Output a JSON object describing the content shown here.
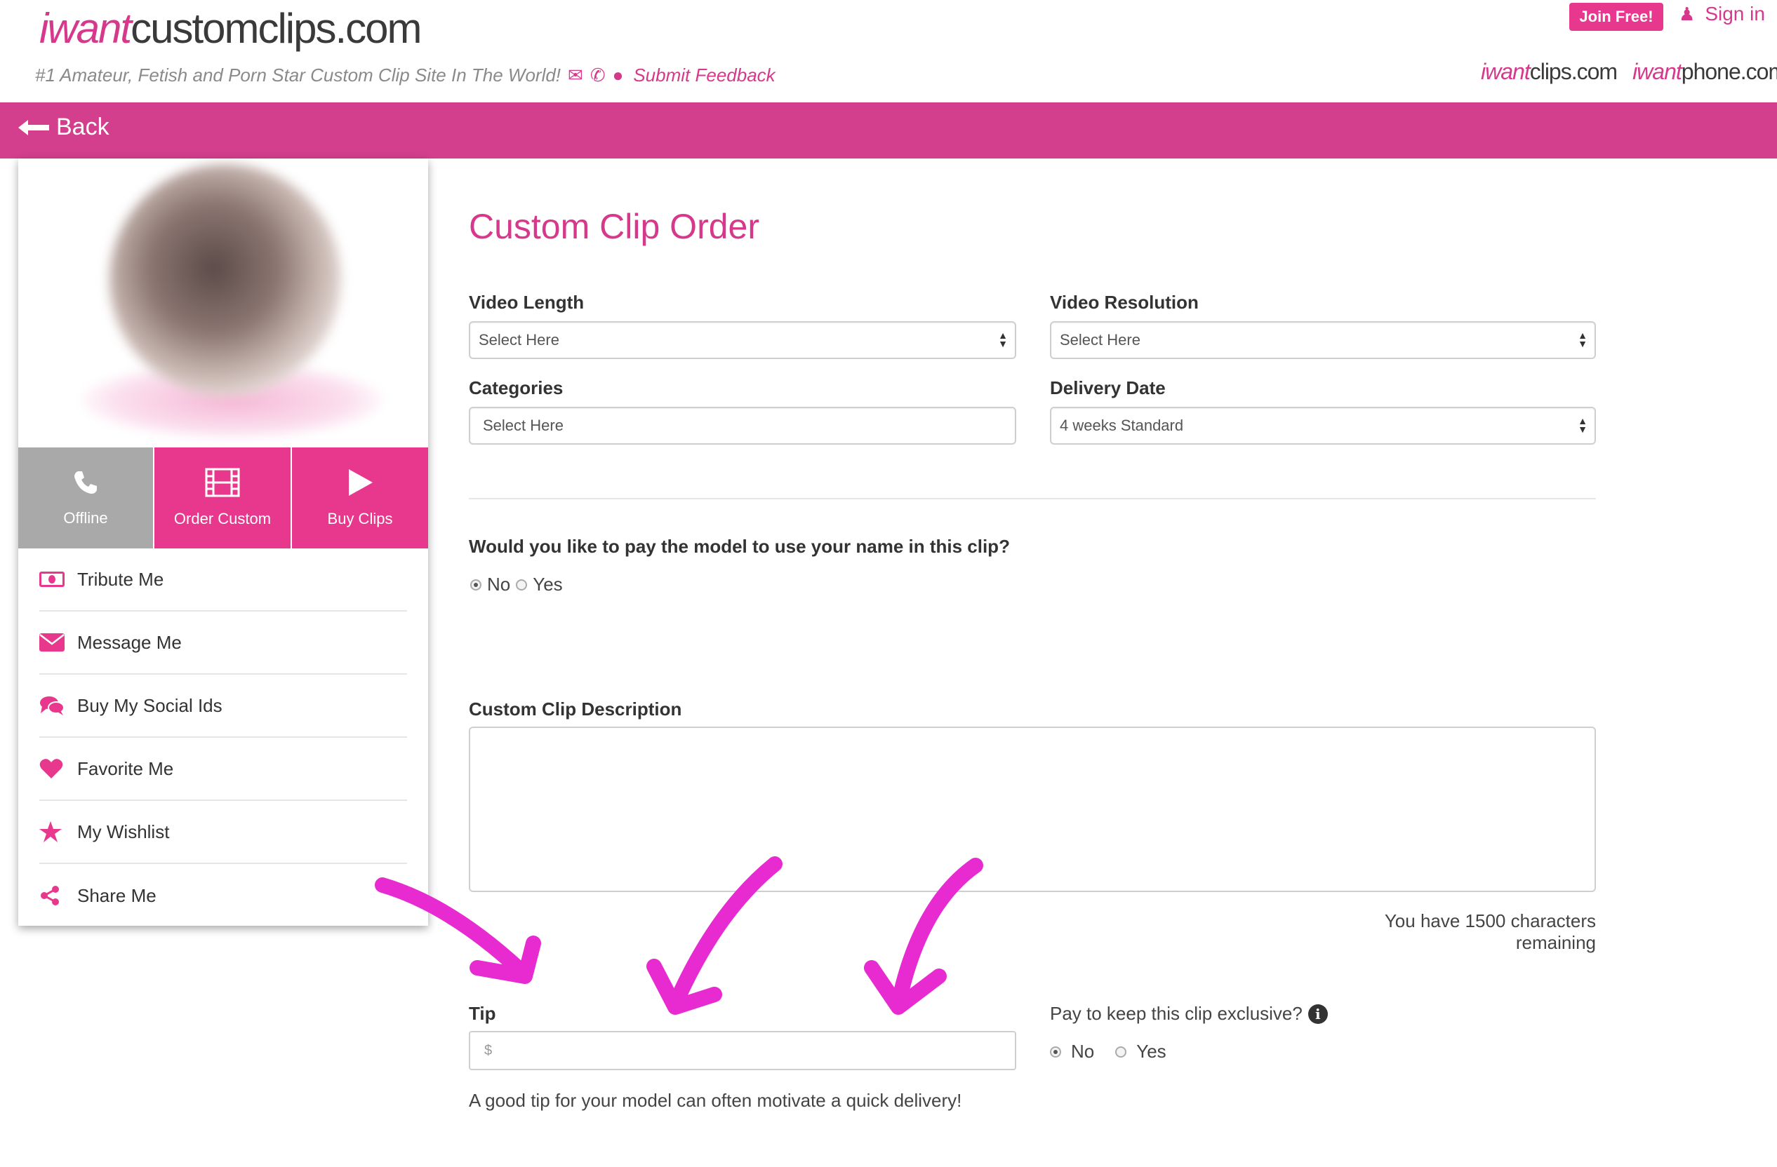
{
  "header": {
    "logo_prefix": "iwant",
    "logo_suffix": "customclips.com",
    "tagline": "#1 Amateur, Fetish and Porn Star Custom Clip Site In The World!",
    "feedback_label": "Submit Feedback",
    "join_label": "Join Free!",
    "signin_label": "Sign in",
    "sister_sites": [
      {
        "prefix": "iwant",
        "suffix": "clips.com"
      },
      {
        "prefix": "iwant",
        "suffix": "phone.com"
      }
    ],
    "icons": [
      "envelope-icon",
      "phone-icon",
      "chat-bubble-icon",
      "user-icon"
    ]
  },
  "topbar": {
    "back_label": "Back",
    "color": "#d43f8d"
  },
  "profile": {
    "actions": [
      {
        "label": "Offline",
        "icon": "phone-icon"
      },
      {
        "label": "Order Custom",
        "icon": "film-icon"
      },
      {
        "label": "Buy Clips",
        "icon": "play-icon"
      }
    ],
    "menu": [
      {
        "label": "Tribute Me",
        "icon": "money-icon"
      },
      {
        "label": "Message Me",
        "icon": "envelope-icon"
      },
      {
        "label": "Buy My Social Ids",
        "icon": "chat-icon"
      },
      {
        "label": "Favorite Me",
        "icon": "heart-icon"
      },
      {
        "label": "My Wishlist",
        "icon": "star-icon"
      },
      {
        "label": "Share Me",
        "icon": "share-icon"
      }
    ]
  },
  "form": {
    "title": "Custom Clip Order",
    "video_length": {
      "label": "Video Length",
      "value": "Select Here"
    },
    "video_resolution": {
      "label": "Video Resolution",
      "value": "Select Here"
    },
    "categories": {
      "label": "Categories",
      "value": "Select Here"
    },
    "delivery_date": {
      "label": "Delivery Date",
      "value": "4 weeks Standard"
    },
    "name_question": "Would you like to pay the model to use your name in this clip?",
    "name_options": [
      "No",
      "Yes"
    ],
    "name_selected": "No",
    "description_label": "Custom Clip Description",
    "description_value": "",
    "chars_remaining": "You have 1500 characters remaining",
    "tip_label": "Tip",
    "tip_placeholder": "$",
    "tip_note": "A good tip for your model can often motivate a quick delivery!",
    "exclusive_label": "Pay to keep this clip exclusive?",
    "exclusive_options": [
      "No",
      "Yes"
    ],
    "exclusive_selected": "No"
  },
  "colors": {
    "brand_pink": "#e8388d",
    "annotation_arrow": "#e82bd0",
    "offline_gray": "#a9a9a9"
  }
}
